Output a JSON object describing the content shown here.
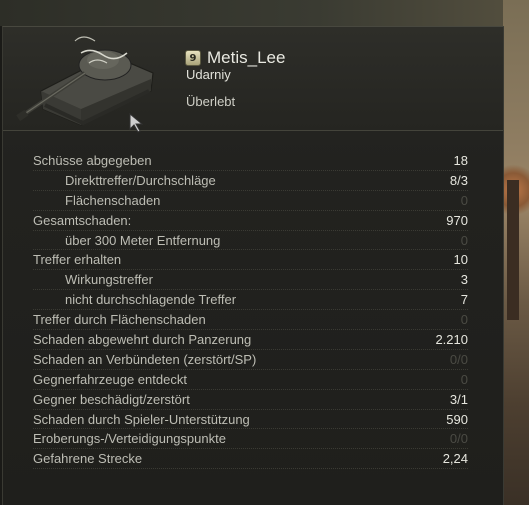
{
  "player": {
    "badge": "9",
    "name": "Metis_Lee",
    "tank": "Udarniy",
    "status": "Überlebt"
  },
  "stats": [
    {
      "label": "Schüsse abgegeben",
      "value": "18",
      "indent": false,
      "muted": false
    },
    {
      "label": "Direkttreffer/Durchschläge",
      "value": "8/3",
      "indent": true,
      "muted": false
    },
    {
      "label": "Flächenschaden",
      "value": "0",
      "indent": true,
      "muted": true
    },
    {
      "label": "Gesamtschaden:",
      "value": "970",
      "indent": false,
      "muted": false
    },
    {
      "label": "über 300 Meter Entfernung",
      "value": "0",
      "indent": true,
      "muted": true
    },
    {
      "label": "Treffer erhalten",
      "value": "10",
      "indent": false,
      "muted": false
    },
    {
      "label": "Wirkungstreffer",
      "value": "3",
      "indent": true,
      "muted": false
    },
    {
      "label": "nicht durchschlagende Treffer",
      "value": "7",
      "indent": true,
      "muted": false
    },
    {
      "label": "Treffer durch Flächenschaden",
      "value": "0",
      "indent": false,
      "muted": true
    },
    {
      "label": "Schaden abgewehrt durch Panzerung",
      "value": "2.210",
      "indent": false,
      "muted": false
    },
    {
      "label": "Schaden an Verbündeten (zerstört/SP)",
      "value": "0/0",
      "indent": false,
      "muted": true
    },
    {
      "label": "Gegnerfahrzeuge entdeckt",
      "value": "0",
      "indent": false,
      "muted": true
    },
    {
      "label": "Gegner beschädigt/zerstört",
      "value": "3/1",
      "indent": false,
      "muted": false
    },
    {
      "label": "Schaden durch Spieler-Unterstützung",
      "value": "590",
      "indent": false,
      "muted": false
    },
    {
      "label": "Eroberungs-/Verteidigungspunkte",
      "value": "0/0",
      "indent": false,
      "muted": true
    },
    {
      "label": "Gefahrene Strecke",
      "value": "2,24",
      "indent": false,
      "muted": false
    }
  ]
}
